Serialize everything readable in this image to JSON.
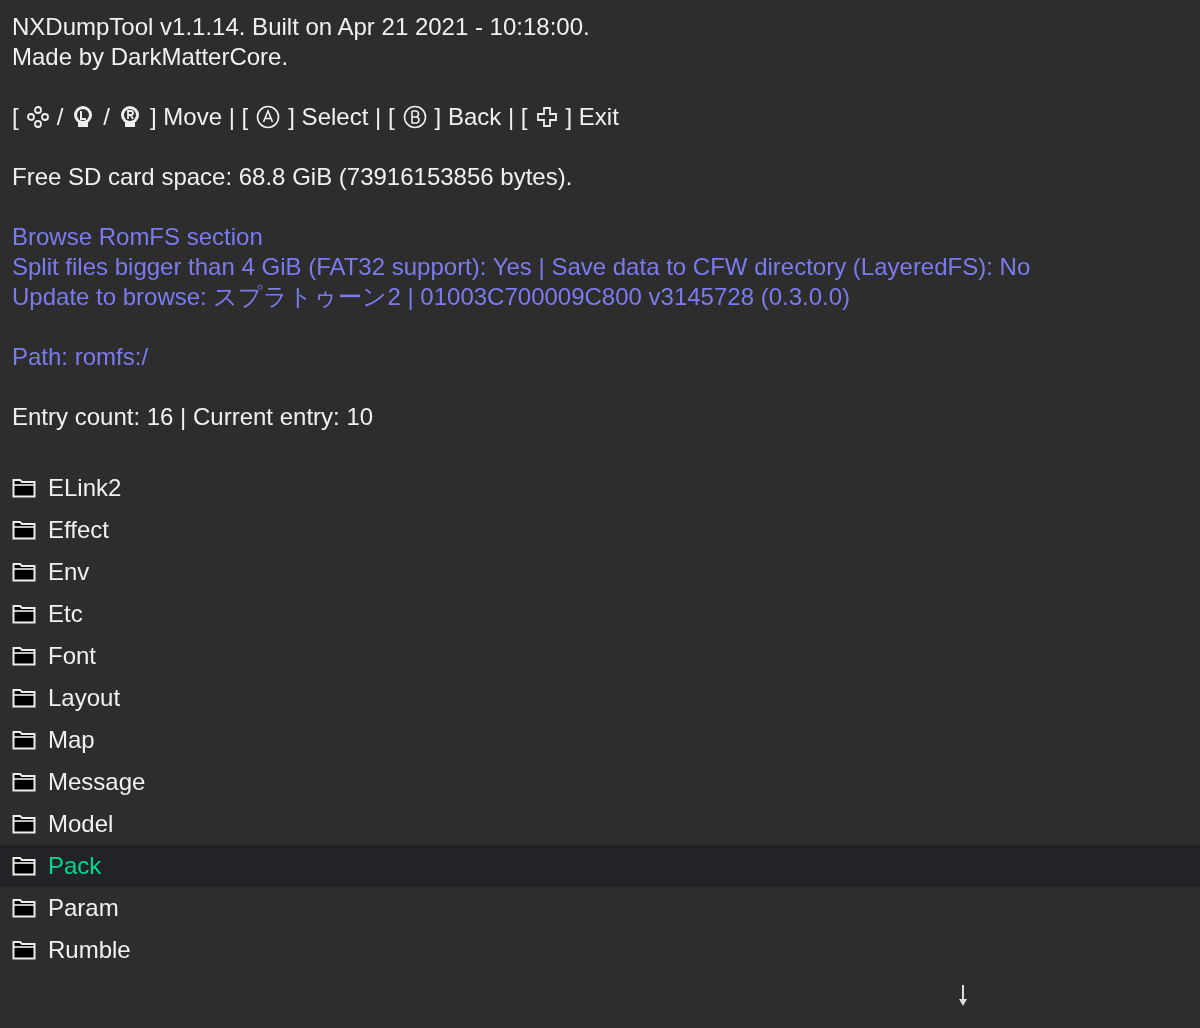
{
  "header": [
    "NXDumpTool v1.1.14. Built on Apr 21 2021 - 10:18:00.",
    "Made by DarkMatterCore."
  ],
  "controls": [
    {
      "kind": "text",
      "text": "["
    },
    {
      "kind": "dpad"
    },
    {
      "kind": "text",
      "text": "/"
    },
    {
      "kind": "lstick"
    },
    {
      "kind": "text",
      "text": "/"
    },
    {
      "kind": "rstick"
    },
    {
      "kind": "text",
      "text": "] Move | ["
    },
    {
      "kind": "abutton"
    },
    {
      "kind": "text",
      "text": "] Select | ["
    },
    {
      "kind": "bbutton"
    },
    {
      "kind": "text",
      "text": "] Back | ["
    },
    {
      "kind": "plus"
    },
    {
      "kind": "text",
      "text": "] Exit"
    }
  ],
  "free_space": "Free SD card space: 68.8 GiB (73916153856 bytes).",
  "info": [
    "Browse RomFS section",
    "Split files bigger than 4 GiB (FAT32 support): Yes | Save data to CFW directory (LayeredFS): No",
    "Update to browse: スプラトゥーン2 | 01003C700009C800 v3145728 (0.3.0.0)"
  ],
  "path": "Path: romfs:/",
  "entry_count": "Entry count: 16 | Current entry: 10",
  "entries": [
    {
      "name": "ELink2",
      "selected": false
    },
    {
      "name": "Effect",
      "selected": false
    },
    {
      "name": "Env",
      "selected": false
    },
    {
      "name": "Etc",
      "selected": false
    },
    {
      "name": "Font",
      "selected": false
    },
    {
      "name": "Layout",
      "selected": false
    },
    {
      "name": "Map",
      "selected": false
    },
    {
      "name": "Message",
      "selected": false
    },
    {
      "name": "Model",
      "selected": false
    },
    {
      "name": "Pack",
      "selected": true
    },
    {
      "name": "Param",
      "selected": false
    },
    {
      "name": "Rumble",
      "selected": false
    }
  ],
  "more_below": true
}
